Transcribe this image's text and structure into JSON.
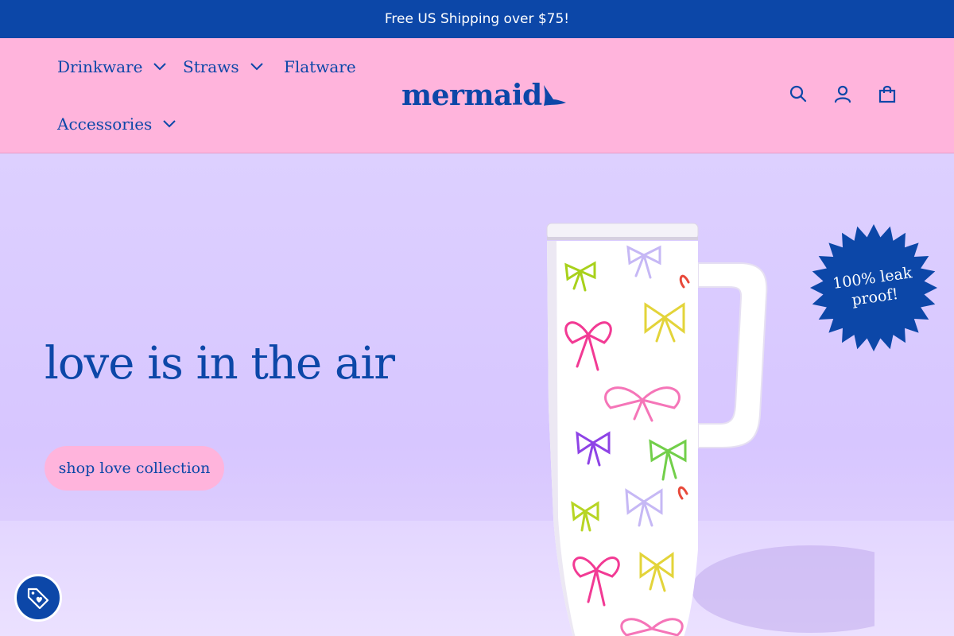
{
  "announcement": "Free US Shipping over $75!",
  "nav": {
    "items": [
      {
        "label": "Drinkware",
        "has_dropdown": true
      },
      {
        "label": "Straws",
        "has_dropdown": true
      },
      {
        "label": "Flatware",
        "has_dropdown": false
      },
      {
        "label": "Accessories",
        "has_dropdown": true
      }
    ]
  },
  "logo": {
    "text": "mermaid"
  },
  "header_icons": [
    "search-icon",
    "account-icon",
    "cart-icon"
  ],
  "hero": {
    "title": "love is in the air",
    "cta_label": "shop love collection",
    "badge_text": "100% leak proof!"
  },
  "colors": {
    "brand_blue": "#0c47a8",
    "header_pink": "#ffb4dc",
    "hero_lavender": "#d7c6ff"
  }
}
